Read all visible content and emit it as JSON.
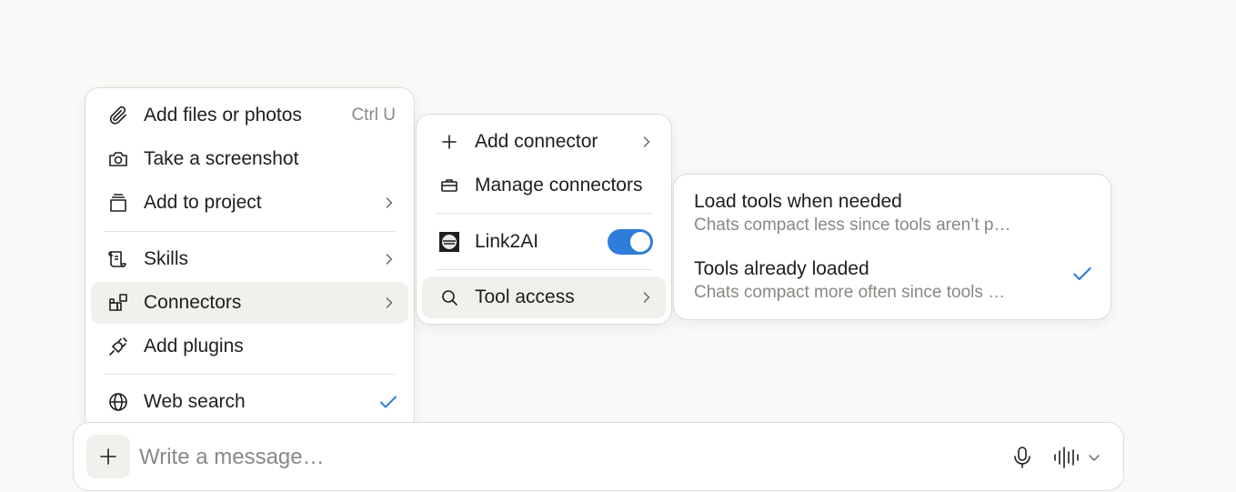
{
  "main_menu": {
    "items": [
      {
        "label": "Add files or photos",
        "shortcut": "Ctrl U",
        "icon": "paperclip-icon"
      },
      {
        "label": "Take a screenshot",
        "icon": "camera-icon"
      },
      {
        "label": "Add to project",
        "icon": "project-stack-icon"
      },
      {
        "label": "Skills",
        "icon": "skills-scroll-icon"
      },
      {
        "label": "Connectors",
        "icon": "connectors-blocks-icon"
      },
      {
        "label": "Add plugins",
        "icon": "plug-icon"
      },
      {
        "label": "Web search",
        "icon": "globe-icon",
        "checked": true
      }
    ]
  },
  "connectors_menu": {
    "items": [
      {
        "label": "Add connector",
        "icon": "plus-icon"
      },
      {
        "label": "Manage connectors",
        "icon": "briefcase-icon"
      },
      {
        "label": "Link2AI",
        "icon": "link2ai-logo-icon",
        "enabled": true
      },
      {
        "label": "Tool access",
        "icon": "search-icon"
      }
    ]
  },
  "tool_access_menu": {
    "options": [
      {
        "title": "Load tools when needed",
        "description": "Chats compact less since tools aren’t p…",
        "selected": false
      },
      {
        "title": "Tools already loaded",
        "description": "Chats compact more often since tools …",
        "selected": true
      }
    ]
  },
  "composer": {
    "placeholder": "Write a message…"
  },
  "colors": {
    "accent": "#2e7ddb",
    "background": "#faf9f7",
    "text": "#1f1e1d",
    "muted_text": "#8a8883"
  }
}
